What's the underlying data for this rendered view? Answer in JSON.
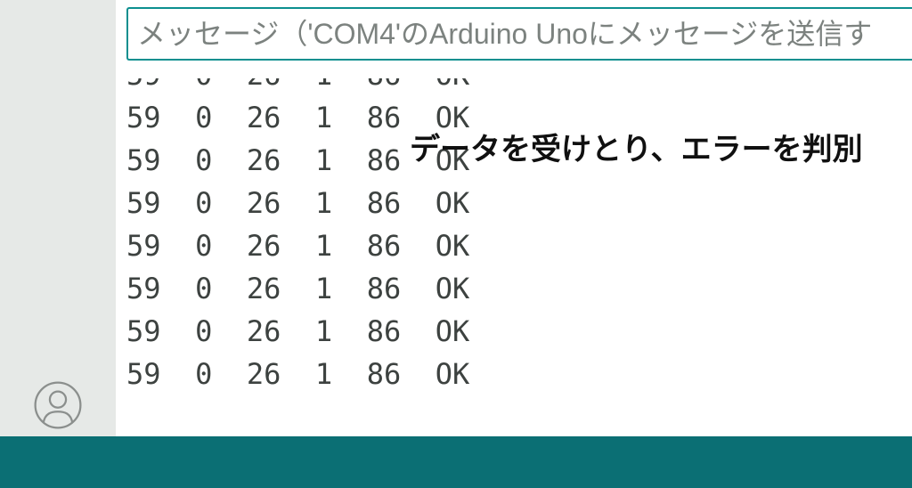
{
  "input": {
    "placeholder": "メッセージ（'COM4'のArduino Unoにメッセージを送信す"
  },
  "serial": {
    "cols": [
      "59",
      "0",
      "26",
      "1",
      "86",
      "OK"
    ],
    "rowCount": 8
  },
  "annotation": {
    "text": "データを受けとり、エラーを判別"
  },
  "colors": {
    "accent": "#0c8f8f",
    "footer": "#0b6f74"
  }
}
